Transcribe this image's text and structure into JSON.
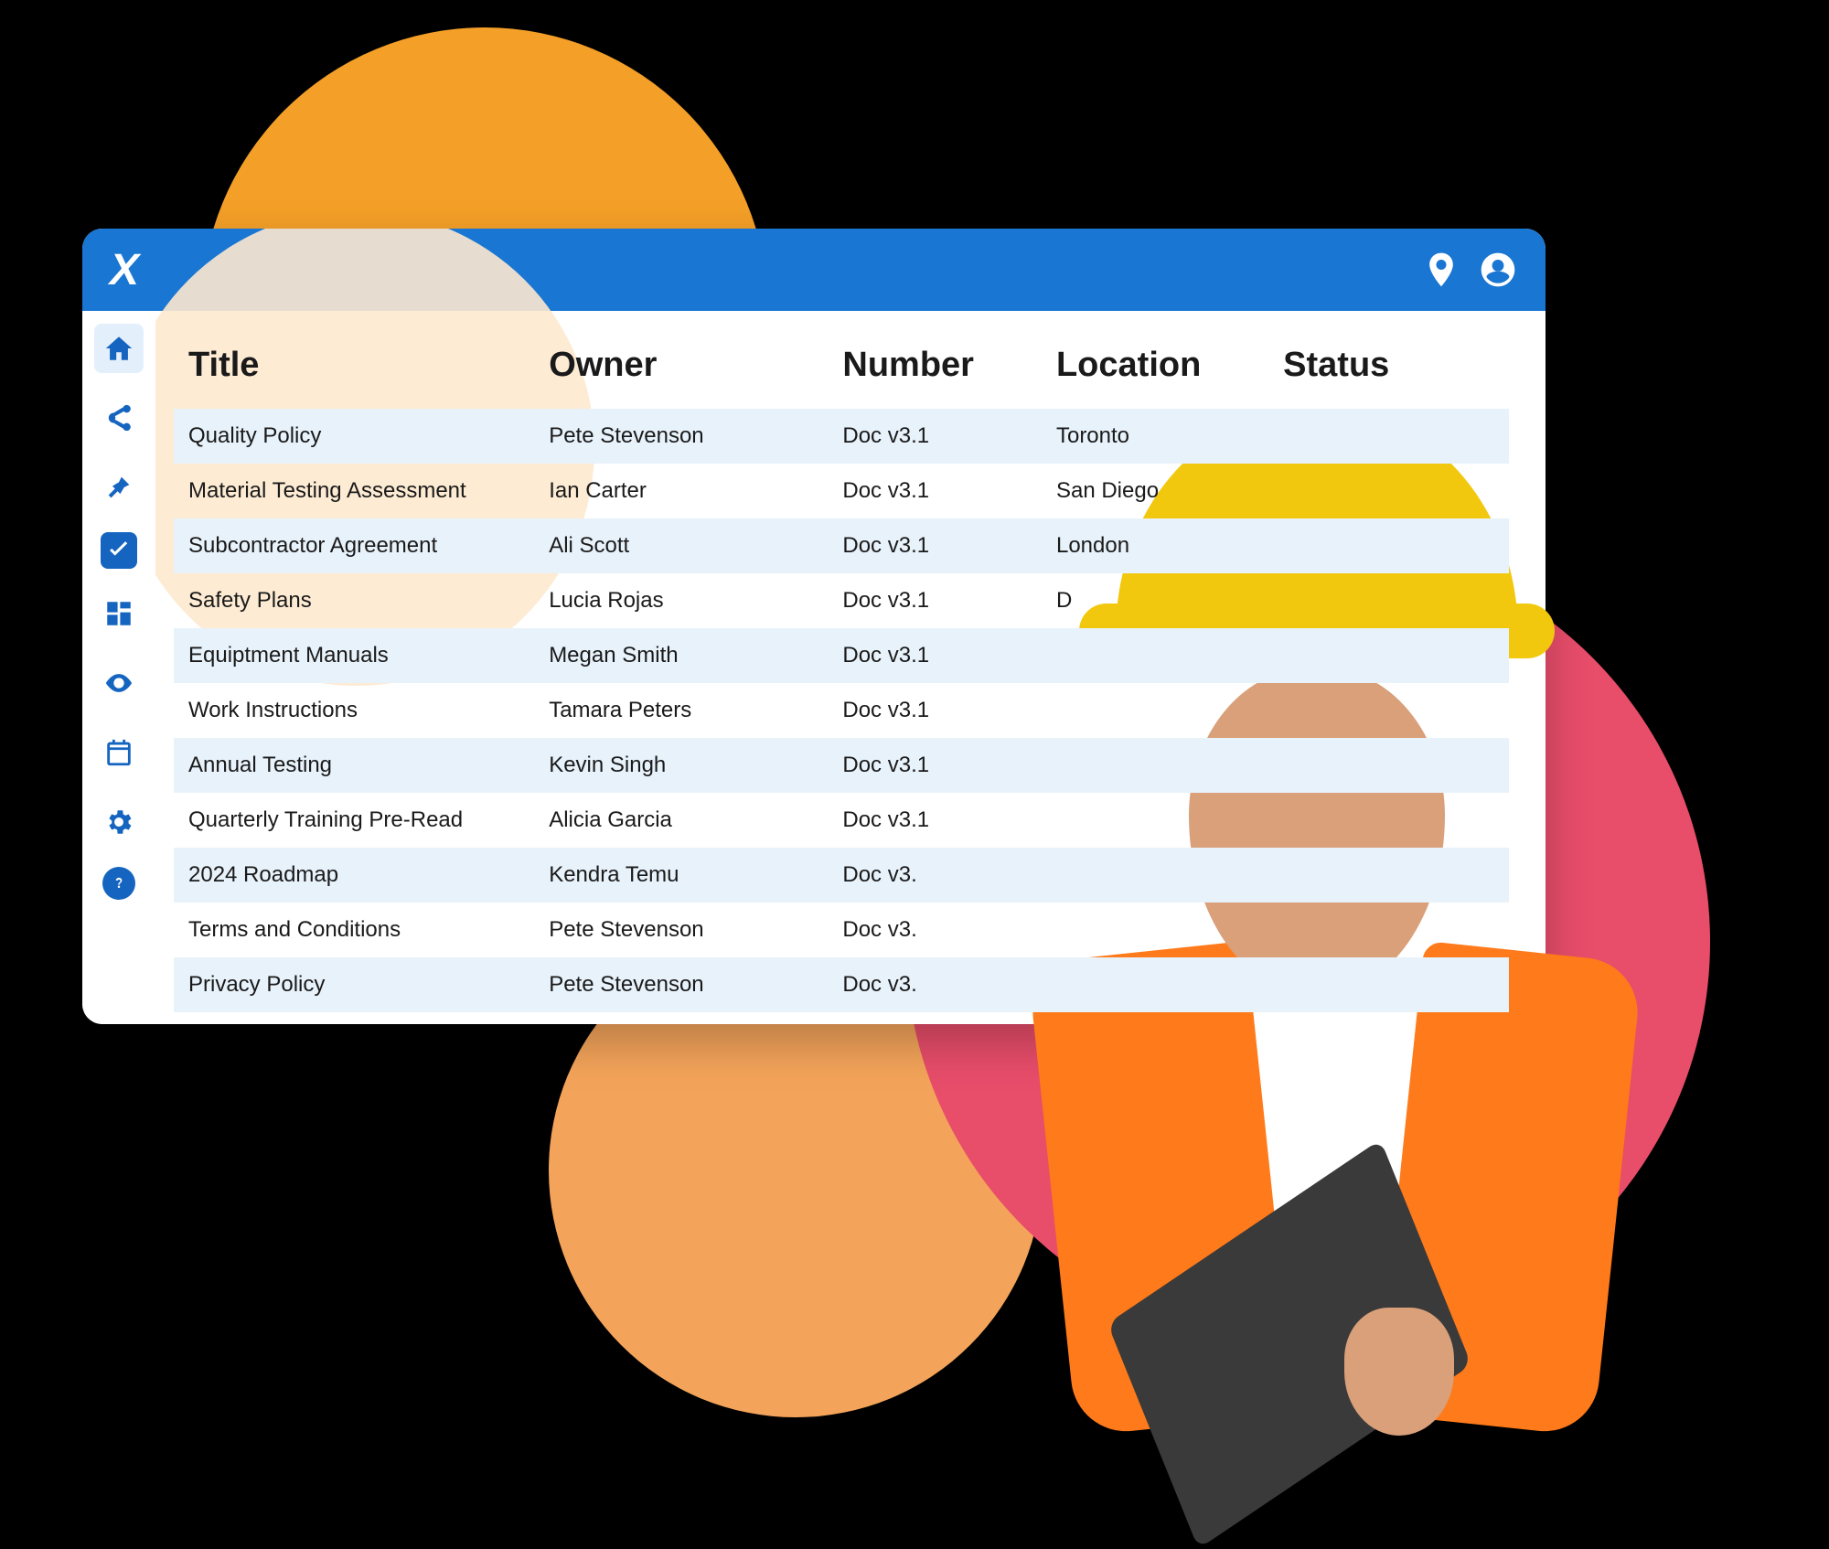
{
  "app": {
    "logo_text": "X"
  },
  "sidebar": {
    "items": [
      {
        "name": "home",
        "active": true
      },
      {
        "name": "share",
        "active": false
      },
      {
        "name": "pin",
        "active": false
      },
      {
        "name": "tasks",
        "active": false
      },
      {
        "name": "dashboard",
        "active": false
      },
      {
        "name": "view",
        "active": false
      },
      {
        "name": "calendar",
        "active": false
      },
      {
        "name": "settings",
        "active": false
      },
      {
        "name": "help",
        "active": false
      }
    ]
  },
  "table": {
    "columns": [
      "Title",
      "Owner",
      "Number",
      "Location",
      "Status"
    ],
    "rows": [
      {
        "title": "Quality Policy",
        "owner": "Pete Stevenson",
        "number": "Doc v3.1",
        "location": "Toronto",
        "status": ""
      },
      {
        "title": "Material Testing Assessment",
        "owner": "Ian Carter",
        "number": "Doc v3.1",
        "location": "San Diego",
        "status": ""
      },
      {
        "title": "Subcontractor Agreement",
        "owner": "Ali Scott",
        "number": "Doc v3.1",
        "location": "London",
        "status": ""
      },
      {
        "title": "Safety Plans",
        "owner": "Lucia Rojas",
        "number": "Doc v3.1",
        "location": "D",
        "status": ""
      },
      {
        "title": "Equiptment Manuals",
        "owner": "Megan Smith",
        "number": "Doc v3.1",
        "location": "",
        "status": ""
      },
      {
        "title": "Work Instructions",
        "owner": "Tamara Peters",
        "number": "Doc v3.1",
        "location": "",
        "status": ""
      },
      {
        "title": "Annual Testing",
        "owner": "Kevin Singh",
        "number": "Doc v3.1",
        "location": "",
        "status": ""
      },
      {
        "title": "Quarterly Training Pre-Read",
        "owner": "Alicia Garcia",
        "number": "Doc v3.1",
        "location": "",
        "status": ""
      },
      {
        "title": "2024 Roadmap",
        "owner": "Kendra Temu",
        "number": "Doc v3.",
        "location": "",
        "status": ""
      },
      {
        "title": "Terms and Conditions",
        "owner": "Pete Stevenson",
        "number": "Doc v3.",
        "location": "",
        "status": ""
      },
      {
        "title": "Privacy Policy",
        "owner": "Pete Stevenson",
        "number": "Doc v3.",
        "location": "",
        "status": ""
      }
    ]
  },
  "colors": {
    "accent": "#1976d2",
    "orange": "#f4a028",
    "peach": "#f4a45a",
    "pink": "#e84d6a"
  }
}
